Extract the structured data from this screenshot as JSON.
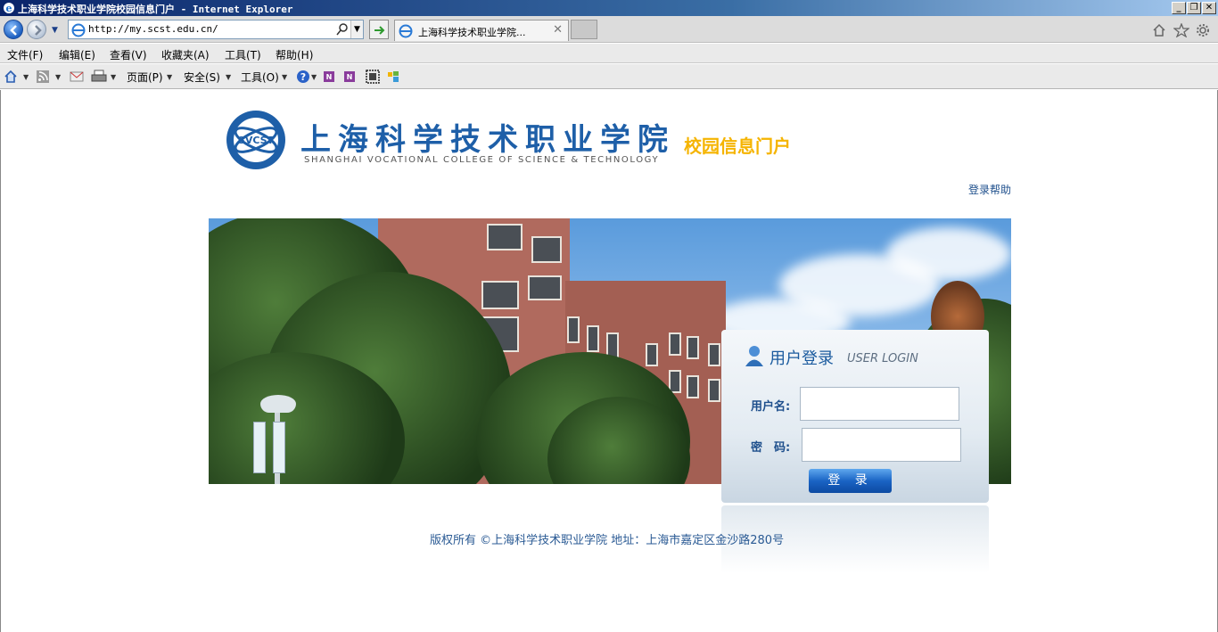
{
  "window": {
    "title": "上海科学技术职业学院校园信息门户 - Internet Explorer",
    "minimize": "_",
    "restore": "❐",
    "close": "✕"
  },
  "navbar": {
    "url": "http://my.scst.edu.cn/",
    "tab_title": "上海科学技术职业学院...",
    "tab_close": "✕"
  },
  "menu": {
    "file": "文件(F)",
    "edit": "编辑(E)",
    "view": "查看(V)",
    "favorites": "收藏夹(A)",
    "tools": "工具(T)",
    "help": "帮助(H)"
  },
  "commandbar": {
    "page": "页面(P)",
    "safety": "安全(S)",
    "tools": "工具(O)"
  },
  "header": {
    "school_name_cn": "上海科学技术职业学院",
    "school_name_en": "SHANGHAI VOCATIONAL COLLEGE OF SCIENCE & TECHNOLOGY",
    "logo_text": "SVCST",
    "portal_label": "校园信息门户",
    "help_link": "登录帮助"
  },
  "login": {
    "title": "用户登录",
    "subtitle": "USER LOGIN",
    "username_label": "用户名:",
    "password_label": "密　码:",
    "username_value": "",
    "password_value": "",
    "submit_label": "登 录"
  },
  "footer": {
    "text": "版权所有 ©上海科学技术职业学院 地址：上海市嘉定区金沙路280号"
  },
  "colors": {
    "brand_blue": "#1e5fa8",
    "portal_gold": "#f5b400",
    "link_blue": "#1e4f8c"
  }
}
